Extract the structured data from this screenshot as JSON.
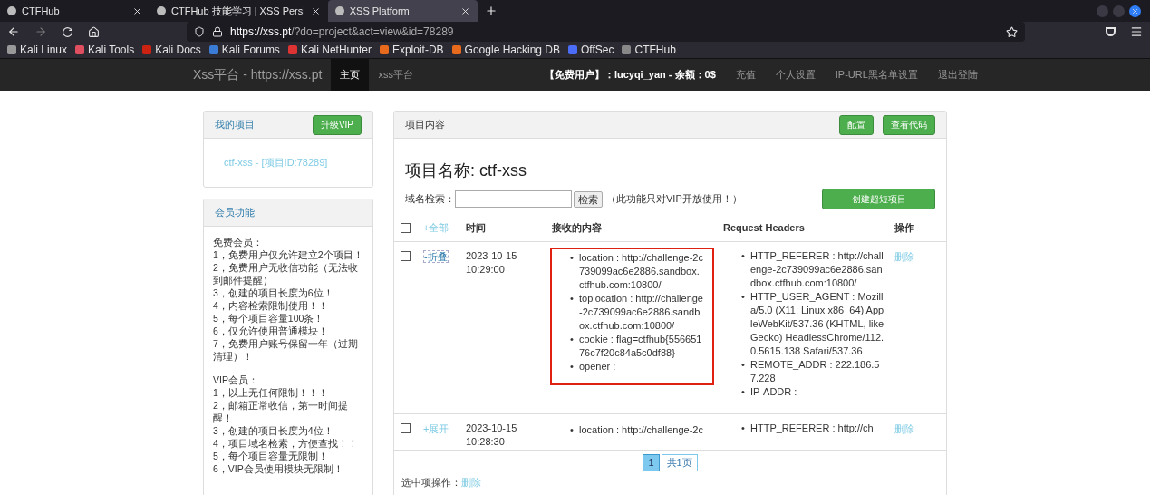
{
  "browser": {
    "tabs": [
      {
        "title": "CTFHub",
        "selected": false
      },
      {
        "title": "CTFHub 技能学习 | XSS Persi",
        "selected": false
      },
      {
        "title": "XSS Platform",
        "selected": true
      }
    ],
    "url_host": "https://xss.pt",
    "url_path": "/?do=project&act=view&id=78289",
    "bookmarks": [
      "Kali Linux",
      "Kali Tools",
      "Kali Docs",
      "Kali Forums",
      "Kali NetHunter",
      "Exploit-DB",
      "Google Hacking DB",
      "OffSec",
      "CTFHub"
    ]
  },
  "site": {
    "brand": "Xss平台 - https://xss.pt",
    "nav": [
      {
        "label": "主页",
        "selected": true
      },
      {
        "label": "xss平台",
        "selected": false
      }
    ],
    "user_info": "【免费用户】：lucyqi_yan - 余额：0$",
    "links": [
      "充值",
      "个人设置",
      "IP-URL黑名单设置",
      "退出登陆"
    ]
  },
  "my_projects": {
    "title": "我的项目",
    "upgrade_button": "升级VIP",
    "project": "ctf-xss - [项目ID:78289]"
  },
  "member": {
    "title": "会员功能",
    "groups": [
      {
        "heading": "免费会员：",
        "items": [
          "1，免费用户仅允许建立2个项目！",
          "2，免费用户无收信功能（无法收到邮件提醒）",
          "3，创建的项目长度为6位！",
          "4，内容检索限制使用！！",
          "5，每个项目容量100条！",
          "6，仅允许使用普通模块！",
          "7，免费用户账号保留一年（过期清理）！"
        ]
      },
      {
        "heading": "VIP会员：",
        "items": [
          "1，以上无任何限制！！！",
          "2，邮箱正常收信，第一时间提醒！",
          "3，创建的项目长度为4位！",
          "4，项目域名检索，方便查找！！",
          "5，每个项目容量无限制！",
          "6，VIP会员使用模块无限制！"
        ]
      }
    ]
  },
  "project": {
    "bullet": "•",
    "panel_title": "项目内容",
    "buttons": [
      "配置",
      "查看代码"
    ],
    "name": "项目名称: ctf-xss",
    "search_label": "域名检索：",
    "search_button": "检索",
    "search_note": "（此功能只对VIP开放使用！）",
    "create_button": "创建超短项目",
    "select_all_checked": false,
    "columns": [
      "+全部",
      "时间",
      "接收的内容",
      "Request Headers",
      "操作"
    ],
    "rows": [
      {
        "checked": false,
        "expanded": true,
        "toggle": "-折叠",
        "date": "2023-10-15",
        "time": "10:29:00",
        "highlighted": true,
        "content": [
          "location : http://challenge-2c739099ac6e2886.sandbox.ctfhub.com:10800/",
          "toplocation : http://challenge-2c739099ac6e2886.sandbox.ctfhub.com:10800/",
          "cookie : flag=ctfhub{55665176c7f20c84a5c0df88}",
          "opener :"
        ],
        "headers": [
          "HTTP_REFERER : http://challenge-2c739099ac6e2886.sandbox.ctfhub.com:10800/",
          "HTTP_USER_AGENT : Mozilla/5.0 (X11; Linux x86_64) AppleWebKit/537.36 (KHTML, like Gecko) HeadlessChrome/112.0.5615.138 Safari/537.36",
          "REMOTE_ADDR : 222.186.57.228",
          "IP-ADDR :"
        ],
        "action": "删除"
      },
      {
        "checked": false,
        "expanded": false,
        "toggle": "+展开",
        "date": "2023-10-15",
        "time": "10:28:30",
        "highlighted": false,
        "content": [
          "location : http://challenge-2c"
        ],
        "headers": [
          "HTTP_REFERER : http://ch"
        ],
        "action": "删除"
      }
    ],
    "pages": [
      {
        "label": "1",
        "selected": true
      },
      {
        "label": "共1页",
        "selected": false
      }
    ],
    "bulk_label": "选中项操作：",
    "bulk_action": "删除"
  }
}
